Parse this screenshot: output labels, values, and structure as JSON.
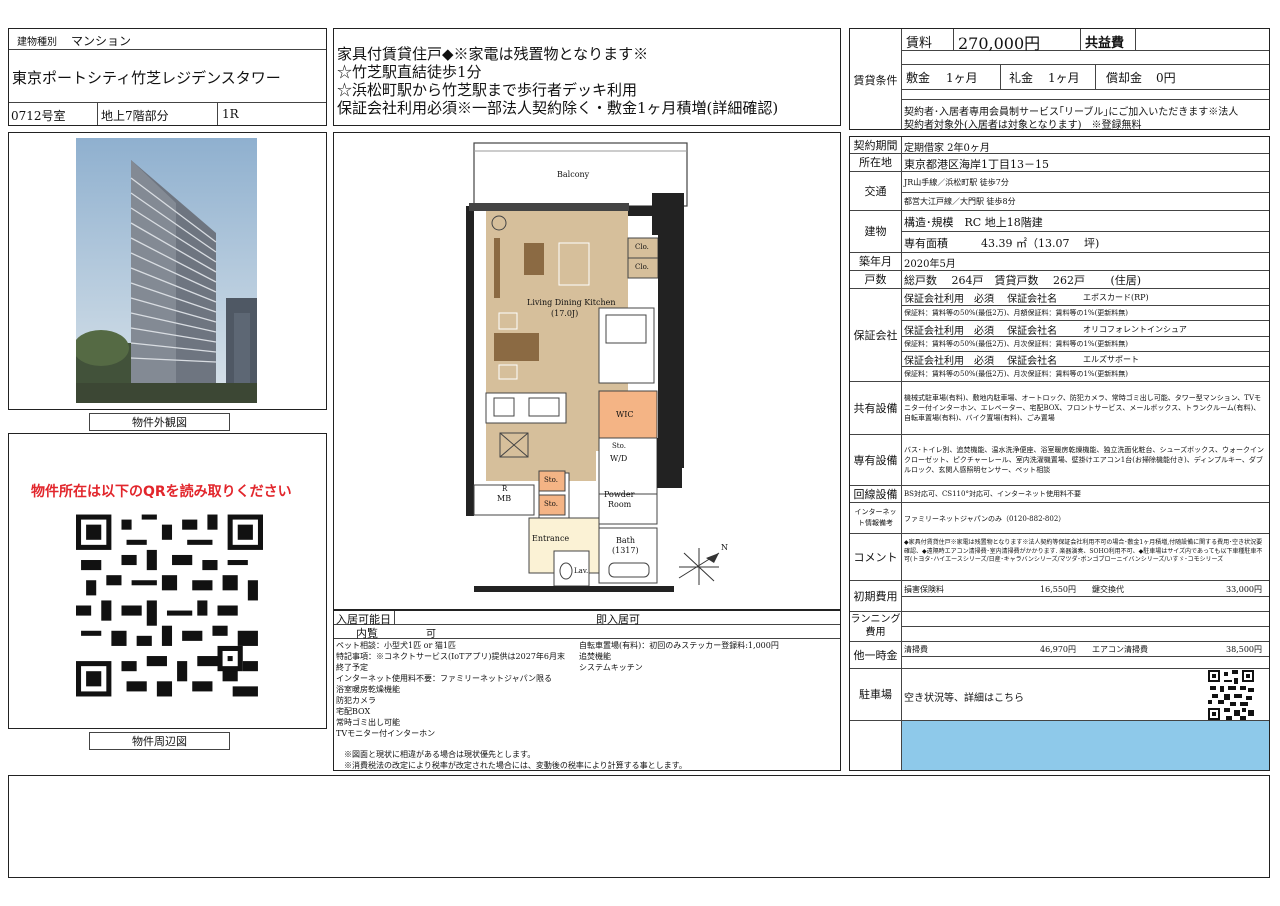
{
  "property": {
    "type_label": "建物種別",
    "type_value": "マンション",
    "name": "東京ポートシティ竹芝レジデンスタワー",
    "room": "0712号室",
    "floor": "地上7階部分",
    "layout": "1R"
  },
  "headline": {
    "lines": [
      "家具付賃貸住戸◆※家電は残置物となります※",
      "☆竹芝駅直結徒歩1分",
      "☆浜松町駅から竹芝駅まで歩行者デッキ利用",
      "保証会社利用必須※一部法人契約除く・敷金1ヶ月積増(詳細確認)"
    ]
  },
  "captions": {
    "exterior": "物件外観図",
    "surroundings": "物件周辺図",
    "qr_notice": "物件所在は以下のQRを読み取りください"
  },
  "floorplan": {
    "balcony": "Balcony",
    "ldk": "Living Dining Kitchen",
    "ldk_size": "(17.0J)",
    "clo1": "Clo.",
    "clo2": "Clo.",
    "wic": "WIC",
    "sto_wd": "Sto.",
    "wd": "W/D",
    "sto1": "Sto.",
    "sto2": "Sto.",
    "mb": "MB",
    "r": "R",
    "powder": "Powder",
    "room": "Room",
    "entrance": "Entrance",
    "bath": "Bath",
    "bath_size": "(1317)",
    "lav": "Lav.",
    "compass": "N"
  },
  "movein": {
    "label": "入居可能日",
    "value": "即入居可",
    "viewing_label": "内覧",
    "viewing_value": "可"
  },
  "features_left": [
    "ペット相談：小型犬1匹 or 猫1匹",
    "特記事項：※コネクトサービス(IoTアプリ)提供は2027年6月末",
    "終了予定",
    "インターネット使用料不要：ファミリーネットジャパン限る",
    "浴室暖房乾燥機能",
    "防犯カメラ",
    "宅配BOX",
    "常時ゴミ出し可能",
    "TVモニター付インターホン"
  ],
  "features_right": [
    "自転車置場(有料)：初回のみステッカー登録料:1,000円",
    "追焚機能",
    "システムキッチン"
  ],
  "notes": [
    "※図面と現状に相違がある場合は現状優先とします。",
    "※消費税法の改定により税率が改定された場合には、変動後の税率により計算する事とします。"
  ],
  "rent": {
    "section_label": "賃貸条件",
    "rent_label": "賃料",
    "rent_value": "270,000円",
    "common_label": "共益費",
    "common_value": "",
    "deposit_label": "敷金",
    "deposit_value": "1ヶ月",
    "key_label": "礼金",
    "key_value": "1ヶ月",
    "amort_label": "償却金",
    "amort_value": "0円",
    "note_lines": [
      "契約者･入居者専用会員制サービス｢リーブル｣にご加入いただきます※法人",
      "契約者対象外(入居者は対象となります)　※登録無料"
    ]
  },
  "spec": {
    "contract_label": "契約期間",
    "contract_value": "定期借家 2年0ヶ月",
    "address_label": "所在地",
    "address_value": "東京都港区海岸1丁目13－15",
    "access_label": "交通",
    "access_1": "JR山手線／浜松町駅 徒歩7分",
    "access_2": "都営大江戸線／大門駅 徒歩8分",
    "building_label": "建物",
    "structure": "構造･規模　RC 地上18階建",
    "area": "専有面積　　　43.39 ㎡（13.07　 坪)",
    "built_label": "築年月",
    "built_value": "2020年5月",
    "units_label": "戸数",
    "units_value": "総戸数　 264戸　賃貸戸数　 262戸　　 (住居)",
    "guarantee_label": "保証会社",
    "guarantee": [
      {
        "line": "保証会社利用　必須　 保証会社名",
        "company": "エポスカード(RP)",
        "fee": "保証料：賃料等の50%(最低2万)、月額保証料：賃料等の1%(更新料無)"
      },
      {
        "line": "保証会社利用　必須　 保証会社名",
        "company": "オリコフォレントインシュア",
        "fee": "保証料：賃料等の50%(最低2万)、月次保証料：賃料等の1%(更新料無)"
      },
      {
        "line": "保証会社利用　必須　 保証会社名",
        "company": "エルズサポート",
        "fee": "保証料：賃料等の50%(最低2万)、月次保証料：賃料等の1%(更新料無)"
      }
    ],
    "shared_label": "共有設備",
    "shared_value": "機械式駐車場(有料)、敷地内駐車場、オートロック、防犯カメラ、常時ゴミ出し可能、タワー型マンション、TVモニター付インターホン、エレベーター、宅配BOX、フロントサービス、メールボックス、トランクルーム(有料)、自転車置場(有料)、バイク置場(有料)、ごみ置場",
    "private_label": "専有設備",
    "private_value": "バス･トイレ別、追焚機能、温水洗浄便座、浴室暖房乾燥機能、独立洗面化粧台、シューズボックス、ウォークインクローゼット、ピクチャーレール、室内洗濯機置場、壁掛けエアコン1台(お掃除機能付き)、ディンプルキー、ダブルロック、玄関人感照明センサー、ペット相談",
    "line_label": "回線設備",
    "line_value": "BS対応可、CS110°対応可、インターネット使用料不要",
    "net_label1": "インターネッ",
    "net_label2": "ト情報備考",
    "net_value": "ファミリーネットジャパンのみ（0120-882-802）",
    "comment_label": "コメント",
    "comment_value": "◆家具付賃貸住戸※家電は残置物となります※法人契約等保証会社利用不可の場合･敷金1ヶ月積増,付随設備に関する費用･空き状況要確認、◆遠隔時エアコン清掃費･室内清掃費がかかります. 楽器演奏、SOHO利用不可、◆駐車場はサイズ内であっても以下車種駐車不可(トヨタ･ハイエースシリーズ/日産･キャラバンシリーズ/マツダ･ボンゴブローニイバンシリーズ/いすゞ･コモシリーズ",
    "initial_label": "初期費用",
    "initial_1_label": "損害保険料",
    "initial_1_value": "16,550円",
    "initial_2_label": "鍵交換代",
    "initial_2_value": "33,000円",
    "running_label1": "ランニング",
    "running_label2": "費用",
    "onetime_label": "他一時金",
    "onetime_1_label": "清掃費",
    "onetime_1_value": "46,970円",
    "onetime_2_label": "エアコン清掃費",
    "onetime_2_value": "38,500円",
    "parking_label": "駐車場",
    "parking_value": "空き状況等、詳細はこちら"
  },
  "colors": {
    "accent_blue": "#8ec9ea",
    "qr_red": "#e2262c",
    "floor_wood": "#d6bf9b",
    "wic_orange": "#f4b485"
  }
}
